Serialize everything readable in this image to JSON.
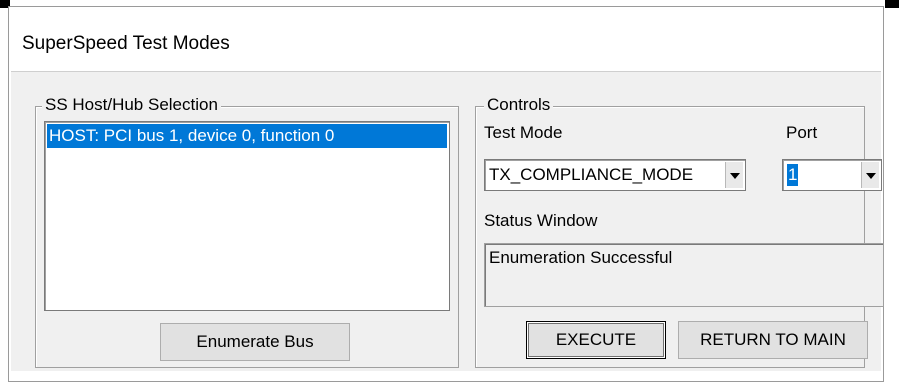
{
  "window": {
    "title": "SuperSpeed Test Modes"
  },
  "host_hub_group": {
    "legend": "SS Host/Hub Selection",
    "items": [
      {
        "label": "HOST: PCI bus 1, device 0, function 0",
        "selected": true
      }
    ],
    "enumerate_label": "Enumerate Bus"
  },
  "controls_group": {
    "legend": "Controls",
    "test_mode_label": "Test Mode",
    "test_mode_value": "TX_COMPLIANCE_MODE",
    "port_label": "Port",
    "port_value": "1",
    "status_label": "Status Window",
    "status_text": "Enumeration Successful",
    "execute_label": "EXECUTE",
    "return_label": "RETURN TO MAIN"
  },
  "colors": {
    "selection": "#0078d7",
    "dialog_bg": "#f0f0f0",
    "button_bg": "#e1e1e1"
  },
  "icons": [
    "dropdown-arrow-icon"
  ]
}
